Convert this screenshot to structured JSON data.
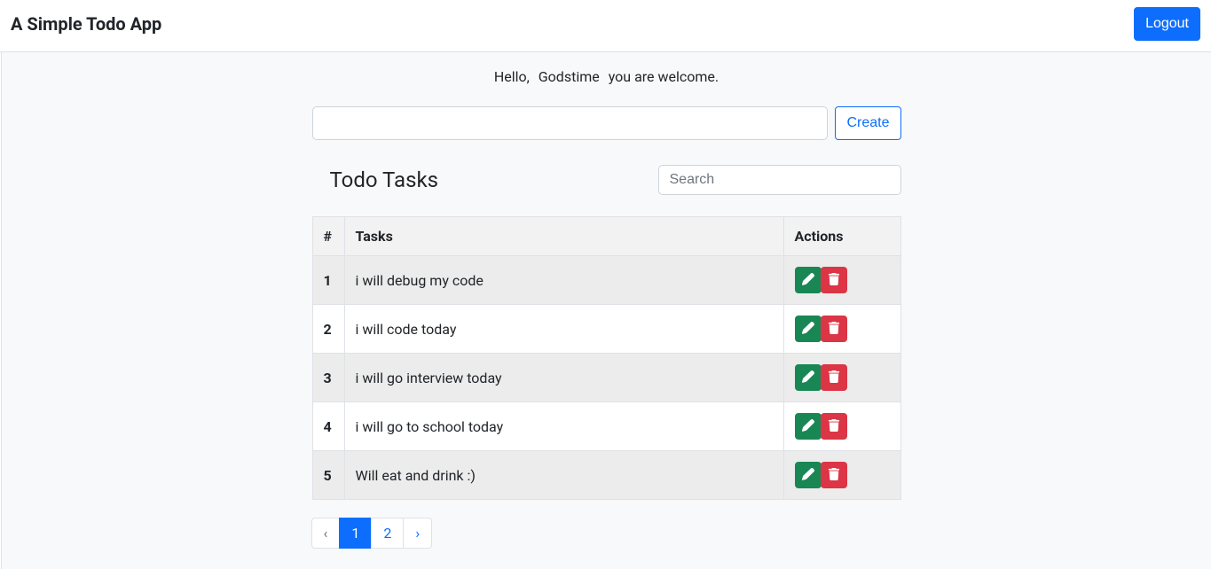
{
  "app": {
    "title": "A Simple Todo App"
  },
  "header": {
    "logout_label": "Logout"
  },
  "greeting": {
    "prefix": "Hello,",
    "username": "Godstime",
    "suffix": "you are welcome."
  },
  "create": {
    "input_value": "",
    "button_label": "Create"
  },
  "section": {
    "title": "Todo Tasks",
    "search_placeholder": "Search",
    "search_value": ""
  },
  "table": {
    "headers": {
      "num": "#",
      "tasks": "Tasks",
      "actions": "Actions"
    },
    "rows": [
      {
        "num": "1",
        "task": "i will debug my code"
      },
      {
        "num": "2",
        "task": "i will code today"
      },
      {
        "num": "3",
        "task": "i will go interview today"
      },
      {
        "num": "4",
        "task": "i will go to school today"
      },
      {
        "num": "5",
        "task": "Will eat and drink :)"
      }
    ]
  },
  "pagination": {
    "prev": "‹",
    "pages": [
      {
        "label": "1",
        "active": true
      },
      {
        "label": "2",
        "active": false
      }
    ],
    "next": "›"
  }
}
